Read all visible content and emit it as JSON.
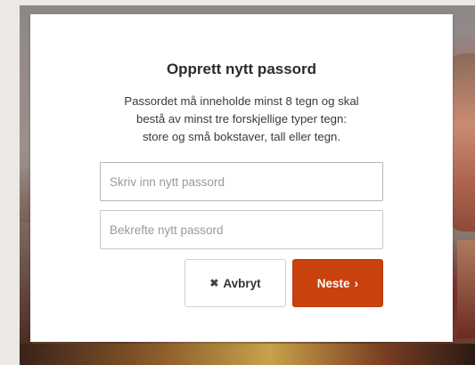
{
  "dialog": {
    "title": "Opprett nytt passord",
    "description_lines": [
      "Passordet må inneholde minst 8 tegn og skal",
      "bestå av minst tre forskjellige typer tegn:",
      "store og små bokstaver, tall eller tegn."
    ],
    "new_password": {
      "placeholder": "Skriv inn nytt passord",
      "value": ""
    },
    "confirm_password": {
      "placeholder": "Bekrefte nytt passord",
      "value": ""
    },
    "cancel_button": {
      "icon": "close-icon",
      "glyph": "✖",
      "label": "Avbryt"
    },
    "next_button": {
      "icon": "chevron-right-icon",
      "glyph": "›",
      "label": "Neste"
    }
  },
  "colors": {
    "primary_button": "#c9410c",
    "title_text": "#2b2b2b",
    "dialog_background": "#ffffff"
  }
}
